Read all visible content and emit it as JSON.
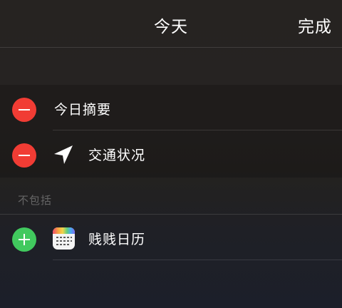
{
  "header": {
    "title": "今天",
    "done_label": "完成"
  },
  "included": {
    "items": [
      {
        "label": "今日摘要",
        "action": "remove"
      },
      {
        "label": "交通状况",
        "icon": "location-arrow-icon",
        "action": "remove"
      }
    ]
  },
  "excluded": {
    "section_title": "不包括",
    "items": [
      {
        "label": "贱贱日历",
        "icon": "calendar-app-icon",
        "action": "add"
      }
    ]
  },
  "colors": {
    "remove": "#f13c34",
    "add": "#41c95e"
  }
}
